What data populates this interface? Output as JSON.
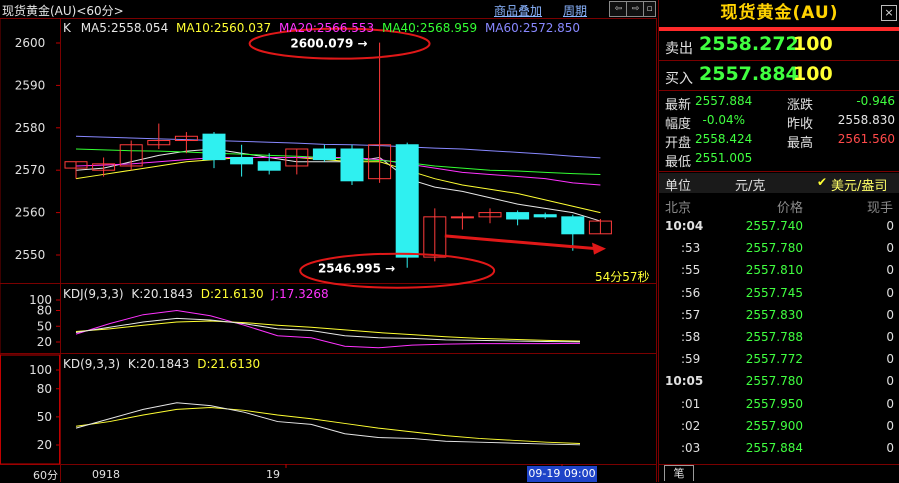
{
  "header": {
    "title": "现货黄金(AU)<60分>",
    "overlay_link": "商品叠加",
    "period_link": "周期"
  },
  "main_chart": {
    "label": "K",
    "ma": [
      {
        "text": "MA5:2558.054",
        "color": "#e6e6e6"
      },
      {
        "text": "MA10:2560.037",
        "color": "#ffff33"
      },
      {
        "text": "MA20:2566.553",
        "color": "#ff33ff"
      },
      {
        "text": "MA40:2568.959",
        "color": "#33ff33"
      },
      {
        "text": "MA60:2572.850",
        "color": "#8888ff"
      }
    ],
    "y_ticks": [
      "2600",
      "2590",
      "2580",
      "2570",
      "2560",
      "2550"
    ],
    "high_label": "2600.079",
    "low_label": "2546.995",
    "countdown": "54分57秒"
  },
  "kdj": {
    "label": "KDJ(9,3,3)",
    "k": "K:20.1843",
    "d": "D:21.6130",
    "j": "J:17.3268",
    "y_ticks": [
      "100",
      "80",
      "50",
      "20"
    ],
    "k_values": [
      38,
      48,
      58,
      65,
      62,
      55,
      45,
      42,
      32,
      28,
      27,
      24,
      23,
      22,
      21,
      20.2
    ],
    "d_values": [
      40,
      45,
      52,
      58,
      60,
      57,
      52,
      48,
      43,
      38,
      34,
      30,
      27,
      25,
      23,
      21.6
    ],
    "j_values": [
      35,
      55,
      72,
      80,
      70,
      52,
      32,
      28,
      12,
      9,
      14,
      16,
      17,
      17,
      17,
      17.3
    ]
  },
  "kd": {
    "label": "KD(9,3,3)",
    "k": "K:20.1843",
    "d": "D:21.6130",
    "y_ticks": [
      "100",
      "80",
      "50",
      "20"
    ]
  },
  "x_axis": {
    "period": "60分",
    "labels": [
      "0918",
      "19"
    ],
    "cursor_label": "09-19 09:00"
  },
  "chart_data": {
    "type": "candlestick",
    "series": [
      {
        "name": "K",
        "open": 2570.5,
        "high": 2572.0,
        "low": 2568.0,
        "close": 2572.0
      },
      {
        "name": "K",
        "open": 2570.0,
        "high": 2573.0,
        "low": 2568.5,
        "close": 2571.5
      },
      {
        "name": "K",
        "open": 2571.0,
        "high": 2577.0,
        "low": 2570.0,
        "close": 2576.0
      },
      {
        "name": "K",
        "open": 2576.0,
        "high": 2581.0,
        "low": 2575.0,
        "close": 2577.0
      },
      {
        "name": "K",
        "open": 2577.0,
        "high": 2579.0,
        "low": 2574.0,
        "close": 2578.0
      },
      {
        "name": "K",
        "open": 2578.5,
        "high": 2579.0,
        "low": 2570.5,
        "close": 2572.5
      },
      {
        "name": "K",
        "open": 2573.0,
        "high": 2576.0,
        "low": 2568.5,
        "close": 2571.5
      },
      {
        "name": "K",
        "open": 2572.0,
        "high": 2574.0,
        "low": 2569.0,
        "close": 2570.0
      },
      {
        "name": "K",
        "open": 2571.0,
        "high": 2575.0,
        "low": 2569.0,
        "close": 2575.0
      },
      {
        "name": "K",
        "open": 2575.0,
        "high": 2576.0,
        "low": 2572.0,
        "close": 2572.5
      },
      {
        "name": "K",
        "open": 2575.0,
        "high": 2576.0,
        "low": 2566.5,
        "close": 2567.5
      },
      {
        "name": "K",
        "open": 2568.0,
        "high": 2600.079,
        "low": 2567.0,
        "close": 2576.0
      },
      {
        "name": "K",
        "open": 2576.0,
        "high": 2576.5,
        "low": 2546.995,
        "close": 2549.5
      },
      {
        "name": "K",
        "open": 2549.5,
        "high": 2561.0,
        "low": 2548.5,
        "close": 2559.0
      },
      {
        "name": "K",
        "open": 2559.0,
        "high": 2560.0,
        "low": 2556.0,
        "close": 2559.0
      },
      {
        "name": "K",
        "open": 2559.0,
        "high": 2561.0,
        "low": 2557.5,
        "close": 2560.0
      },
      {
        "name": "K",
        "open": 2560.0,
        "high": 2560.5,
        "low": 2557.0,
        "close": 2558.5
      },
      {
        "name": "K",
        "open": 2559.5,
        "high": 2560.0,
        "low": 2558.5,
        "close": 2559.0
      },
      {
        "name": "K",
        "open": 2559.0,
        "high": 2559.5,
        "low": 2551.0,
        "close": 2555.0
      },
      {
        "name": "K",
        "open": 2555.0,
        "high": 2558.5,
        "low": 2555.0,
        "close": 2558.0
      }
    ],
    "ma": {
      "MA5": [
        2570,
        2570.5,
        2572,
        2573.5,
        2574.5,
        2575,
        2574,
        2573,
        2572,
        2572,
        2572,
        2573,
        2568,
        2566,
        2565,
        2563.5,
        2562,
        2561,
        2560,
        2558
      ],
      "MA10": [
        2568,
        2569,
        2570,
        2571,
        2572,
        2572.5,
        2573,
        2573,
        2573,
        2572.5,
        2572,
        2572,
        2570,
        2568,
        2566.5,
        2565.5,
        2564.5,
        2563,
        2561.5,
        2560
      ],
      "MA20": [
        2571,
        2571.2,
        2571.5,
        2572,
        2572.5,
        2573,
        2573,
        2573,
        2573,
        2573,
        2573,
        2572.5,
        2571.5,
        2570.5,
        2569.5,
        2569,
        2568.5,
        2568,
        2567,
        2566.5
      ],
      "MA40": [
        2575,
        2574.8,
        2574.6,
        2574.5,
        2574.3,
        2574,
        2573.8,
        2573.5,
        2573.3,
        2573,
        2572.5,
        2572.3,
        2571.8,
        2571,
        2570.5,
        2570,
        2569.8,
        2569.5,
        2569.2,
        2569
      ],
      "MA60": [
        2578,
        2577.8,
        2577.6,
        2577.4,
        2577.2,
        2577,
        2576.8,
        2576.6,
        2576.4,
        2576.1,
        2576,
        2575.8,
        2575.5,
        2575.2,
        2575,
        2574.6,
        2574.2,
        2573.8,
        2573.3,
        2572.9
      ]
    },
    "ylim": [
      2546,
      2603
    ]
  },
  "panel": {
    "title": "现货黄金(AU)",
    "sell_label": "卖出",
    "sell_price": "2558.272",
    "sell_qty": "100",
    "buy_label": "买入",
    "buy_price": "2557.884",
    "buy_qty": "100",
    "quote": [
      {
        "l1": "最新",
        "v1": "2557.884",
        "c1": "green",
        "l2": "涨跌",
        "v2": "-0.946",
        "c2": "green"
      },
      {
        "l1": "幅度",
        "v1": "-0.04%",
        "c1": "green",
        "l2": "昨收",
        "v2": "2558.830",
        "c2": "white"
      },
      {
        "l1": "开盘",
        "v1": "2558.424",
        "c1": "green",
        "l2": "最高",
        "v2": "2561.560",
        "c2": "red"
      },
      {
        "l1": "最低",
        "v1": "2551.005",
        "c1": "green",
        "l2": "",
        "v2": "",
        "c2": "white"
      }
    ],
    "unit_label": "单位",
    "unit_value": "元/克",
    "alt_unit": "美元/盎司",
    "tick_headers": [
      "北京",
      "价格",
      "现手"
    ],
    "ticks": [
      {
        "time": "10:04",
        "price": "2557.740",
        "vol": "0"
      },
      {
        "time": ":53",
        "price": "2557.780",
        "vol": "0"
      },
      {
        "time": ":55",
        "price": "2557.810",
        "vol": "0"
      },
      {
        "time": ":56",
        "price": "2557.745",
        "vol": "0"
      },
      {
        "time": ":57",
        "price": "2557.830",
        "vol": "0"
      },
      {
        "time": ":58",
        "price": "2557.788",
        "vol": "0"
      },
      {
        "time": ":59",
        "price": "2557.772",
        "vol": "0"
      },
      {
        "time": "10:05",
        "price": "2557.780",
        "vol": "0"
      },
      {
        "time": ":01",
        "price": "2557.950",
        "vol": "0"
      },
      {
        "time": ":02",
        "price": "2557.900",
        "vol": "0"
      },
      {
        "time": ":03",
        "price": "2557.884",
        "vol": "0"
      }
    ],
    "bottom_tab": "笔"
  }
}
